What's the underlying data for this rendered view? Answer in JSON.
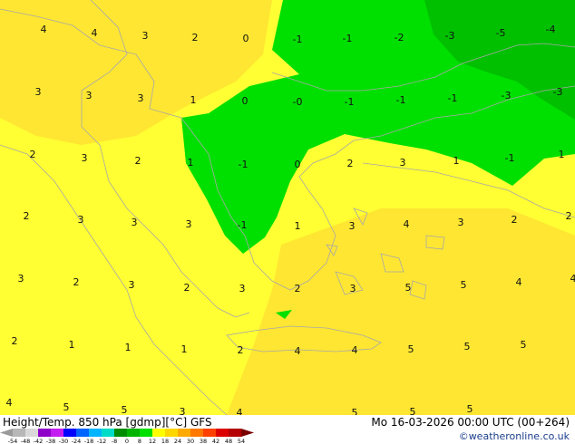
{
  "footer": {
    "title": "Height/Temp. 850 hPa [gdmp][°C] GFS",
    "datetime": "Mo 16-03-2026 00:00 UTC (00+264)",
    "credit": "©weatheronline.co.uk"
  },
  "legend": {
    "ticks": [
      "-54",
      "-48",
      "-42",
      "-38",
      "-30",
      "-24",
      "-18",
      "-12",
      "-8",
      "0",
      "8",
      "12",
      "18",
      "24",
      "30",
      "38",
      "42",
      "48",
      "54"
    ],
    "colors": [
      "#9a9a9a",
      "#b7b7b7",
      "#d9d9d9",
      "#8f00c8",
      "#c31cf0",
      "#0000ff",
      "#0064ff",
      "#00b4ff",
      "#00dcc8",
      "#008c00",
      "#00b400",
      "#00e000",
      "#ffff00",
      "#ffd700",
      "#ffaa00",
      "#ff7800",
      "#ff4000",
      "#dc0000",
      "#b40000",
      "#7a0000"
    ]
  },
  "map": {
    "field_colors": {
      "warm_pale": "#ffff33",
      "warm_deep": "#ffe632",
      "cold_light": "#00e000",
      "cold_dark": "#00c000"
    },
    "contour_values": [
      "4",
      "4",
      "3",
      "2",
      "0",
      "-1",
      "-1",
      "-2",
      "-3",
      "-5",
      "-4",
      "3",
      "3",
      "3",
      "1",
      "0",
      "-0",
      "-1",
      "-1",
      "-1",
      "-3",
      "-3",
      "2",
      "3",
      "2",
      "1",
      "-1",
      "0",
      "2",
      "3",
      "1",
      "-1",
      "1",
      "2",
      "3",
      "3",
      "3",
      "-1",
      "1",
      "3",
      "4",
      "3",
      "2",
      "2",
      "3",
      "2",
      "3",
      "2",
      "3",
      "2",
      "3",
      "5",
      "5",
      "4",
      "4",
      "2",
      "1",
      "1",
      "1",
      "2",
      "4",
      "4",
      "5",
      "5",
      "5",
      "4",
      "5",
      "5",
      "3",
      "4",
      "5",
      "5",
      "5"
    ]
  }
}
